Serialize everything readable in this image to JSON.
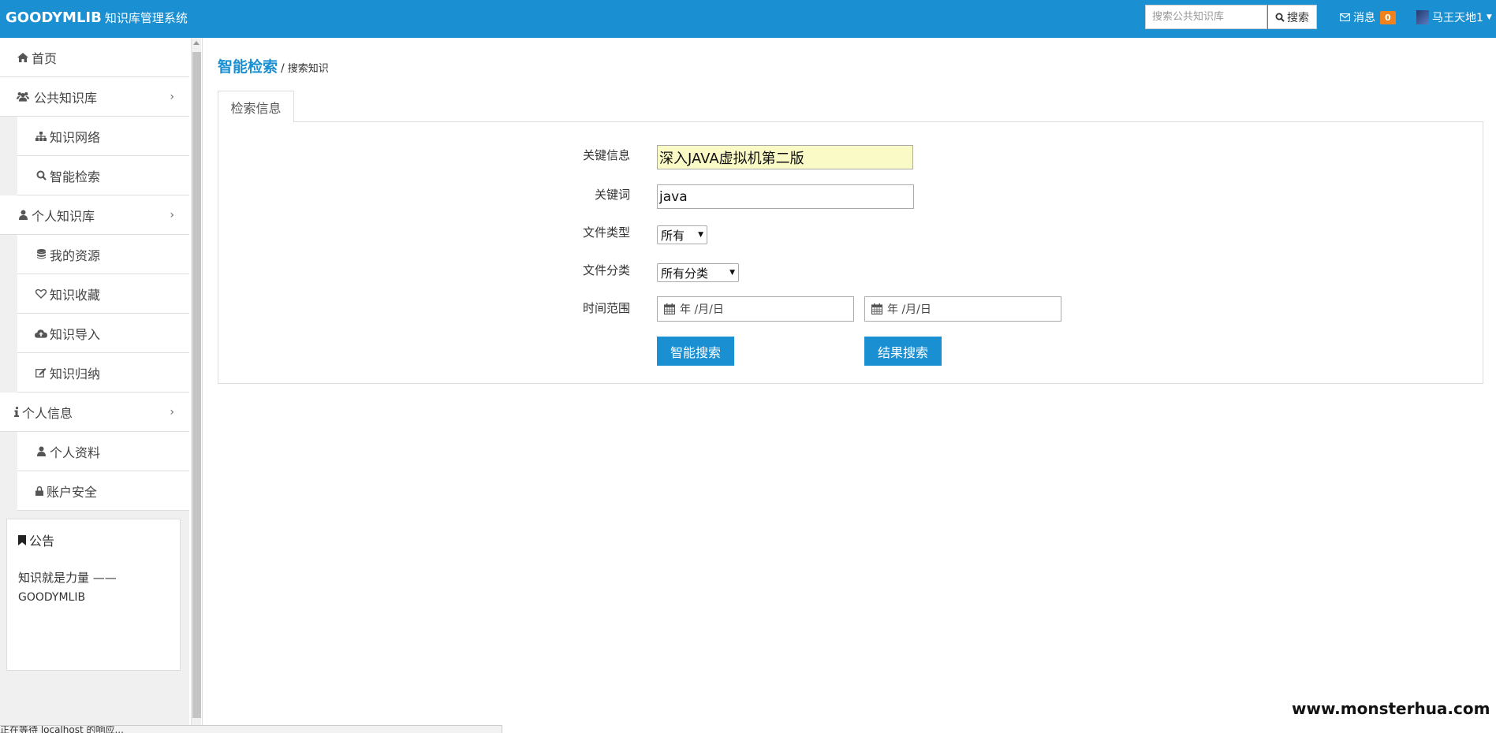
{
  "header": {
    "brand": "GOODYMLIB",
    "brand_sub": "知识库管理系统",
    "search_placeholder": "搜索公共知识库",
    "search_button": "搜索",
    "messages_label": "消息",
    "messages_count": "0",
    "username": "马王天地1"
  },
  "sidebar": {
    "items": [
      {
        "label": "首页",
        "icon": "home-icon"
      },
      {
        "label": "公共知识库",
        "icon": "users-icon"
      },
      {
        "label": "知识网络",
        "icon": "sitemap-icon"
      },
      {
        "label": "智能检索",
        "icon": "search-icon"
      },
      {
        "label": "个人知识库",
        "icon": "user-icon"
      },
      {
        "label": "我的资源",
        "icon": "database-icon"
      },
      {
        "label": "知识收藏",
        "icon": "heart-icon"
      },
      {
        "label": "知识导入",
        "icon": "cloud-upload-icon"
      },
      {
        "label": "知识归纳",
        "icon": "edit-icon"
      },
      {
        "label": "个人信息",
        "icon": "info-icon"
      },
      {
        "label": "个人资料",
        "icon": "user-icon"
      },
      {
        "label": "账户安全",
        "icon": "lock-icon"
      }
    ],
    "notice": {
      "title": "公告",
      "body_line1": "知识就是力量 ——",
      "body_line2": "GOODYMLIB"
    }
  },
  "main": {
    "breadcrumb_main": "智能检索",
    "breadcrumb_sep": "/",
    "breadcrumb_sub": "搜索知识",
    "tab_label": "检索信息",
    "form": {
      "keyinfo_label": "关键信息",
      "keyinfo_value": "深入JAVA虚拟机第二版",
      "keyword_label": "关键词",
      "keyword_value": "java",
      "filetype_label": "文件类型",
      "filetype_value": "所有",
      "filecat_label": "文件分类",
      "filecat_value": "所有分类",
      "timerange_label": "时间范围",
      "date_start_placeholder": "年 /月/日",
      "date_end_placeholder": "年 /月/日",
      "smart_search_button": "智能搜索",
      "result_search_button": "结果搜索"
    }
  },
  "watermark": "www.monsterhua.com",
  "statusbar": "正在等待 localhost 的响应..."
}
